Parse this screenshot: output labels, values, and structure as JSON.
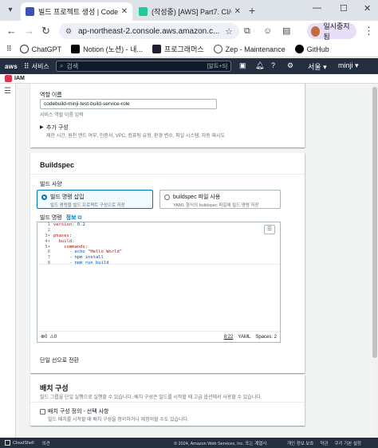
{
  "browser": {
    "tabs": [
      {
        "title": "빌드 프로젝트 생성 | CodeBuild",
        "active": true
      },
      {
        "title": "(작성중) [AWS] Part7. CI/CD",
        "active": false
      }
    ],
    "url": "ap-northeast-2.console.aws.amazon.c...",
    "pause_label": "일시중지됨",
    "bookmarks": [
      "ChatGPT",
      "Notion (노션) - 내...",
      "프로그래머스",
      "Zep - Maintenance",
      "GitHub"
    ]
  },
  "aws_header": {
    "logo": "aws",
    "services_label": "서비스",
    "search_placeholder": "검색",
    "search_shortcut": "[알트+S]",
    "region": "서울",
    "user": "minji"
  },
  "service_nav": {
    "label": "IAM"
  },
  "role": {
    "label": "역할 이름",
    "value": "codebuild-minji-test-build-service-role",
    "hint": "서비스 역할 이름 입력"
  },
  "additional_config": {
    "title": "추가 구성",
    "desc": "제한 시간, 원천 엔드 여부, 인증서, VPC, 컴퓨팅 유형, 환경 변수, 파일 시스템, 자동 재시도"
  },
  "buildspec": {
    "heading": "Buildspec",
    "build_spec_label": "빌드 사양",
    "options": [
      {
        "title": "빌드 명령 삽입",
        "desc": "빌드 명령을 빌드 프로젝트 구성으로 저장",
        "selected": true
      },
      {
        "title": "buildspec 파일 사용",
        "desc": "YAML 형식의 buildspec 파일에 빌드 명령 저장",
        "selected": false
      }
    ],
    "commands_label": "빌드 명령",
    "info_link": "정보",
    "editor": {
      "line_numbers": [
        "1",
        "2",
        "3",
        "4",
        "5",
        "6",
        "7",
        "8"
      ],
      "fold_markers": [
        "",
        "",
        "▾",
        "▾",
        "▾",
        "",
        "",
        ""
      ],
      "lines": [
        {
          "key": "version",
          "sep": ": ",
          "val": "0.2",
          "indent": ""
        },
        {
          "key": "",
          "sep": "",
          "val": "",
          "indent": ""
        },
        {
          "key": "phases",
          "sep": ":",
          "val": "",
          "indent": ""
        },
        {
          "key": "build",
          "sep": ":",
          "val": "",
          "indent": "  "
        },
        {
          "key": "commands",
          "sep": ":",
          "val": "",
          "indent": "    "
        },
        {
          "key": "",
          "sep": "- echo ",
          "val": "\"Hello World\"",
          "indent": "      "
        },
        {
          "key": "",
          "sep": "- npm install",
          "val": "",
          "indent": "      "
        },
        {
          "key": "",
          "sep": "- npm run build",
          "val": "",
          "indent": "      "
        }
      ],
      "errors": "0",
      "warnings": "0",
      "cursor": "8:22",
      "language": "YAML",
      "spaces": "Spaces: 2"
    },
    "switch_editor": "단일 선으로 전환"
  },
  "batch": {
    "heading": "배치 구성",
    "desc": "빌드 그룹을 단일 실행으로 실행할 수 있습니다. 배치 구성은 빌드를 시작할 때 고급 옵션에서 사용할 수 있습니다.",
    "checkbox_label": "배치 구성 정의 - 선택 사항",
    "checkbox_desc": "빌드 배치를 시작할 때 배치 구성을 정의하거나 재정의할 수도 있습니다."
  },
  "footer": {
    "cloudshell": "CloudShell",
    "feedback": "의견",
    "copyright": "© 2024, Amazon Web Services, Inc. 또는 계열사.",
    "links": [
      "개인 정보 보호",
      "약관",
      "쿠키 기본 설정"
    ]
  },
  "colors": {
    "aws_nav": "#232f3e",
    "link_blue": "#0073bb",
    "panel_bg": "#ffffff",
    "page_bg": "#f2f3f3"
  }
}
